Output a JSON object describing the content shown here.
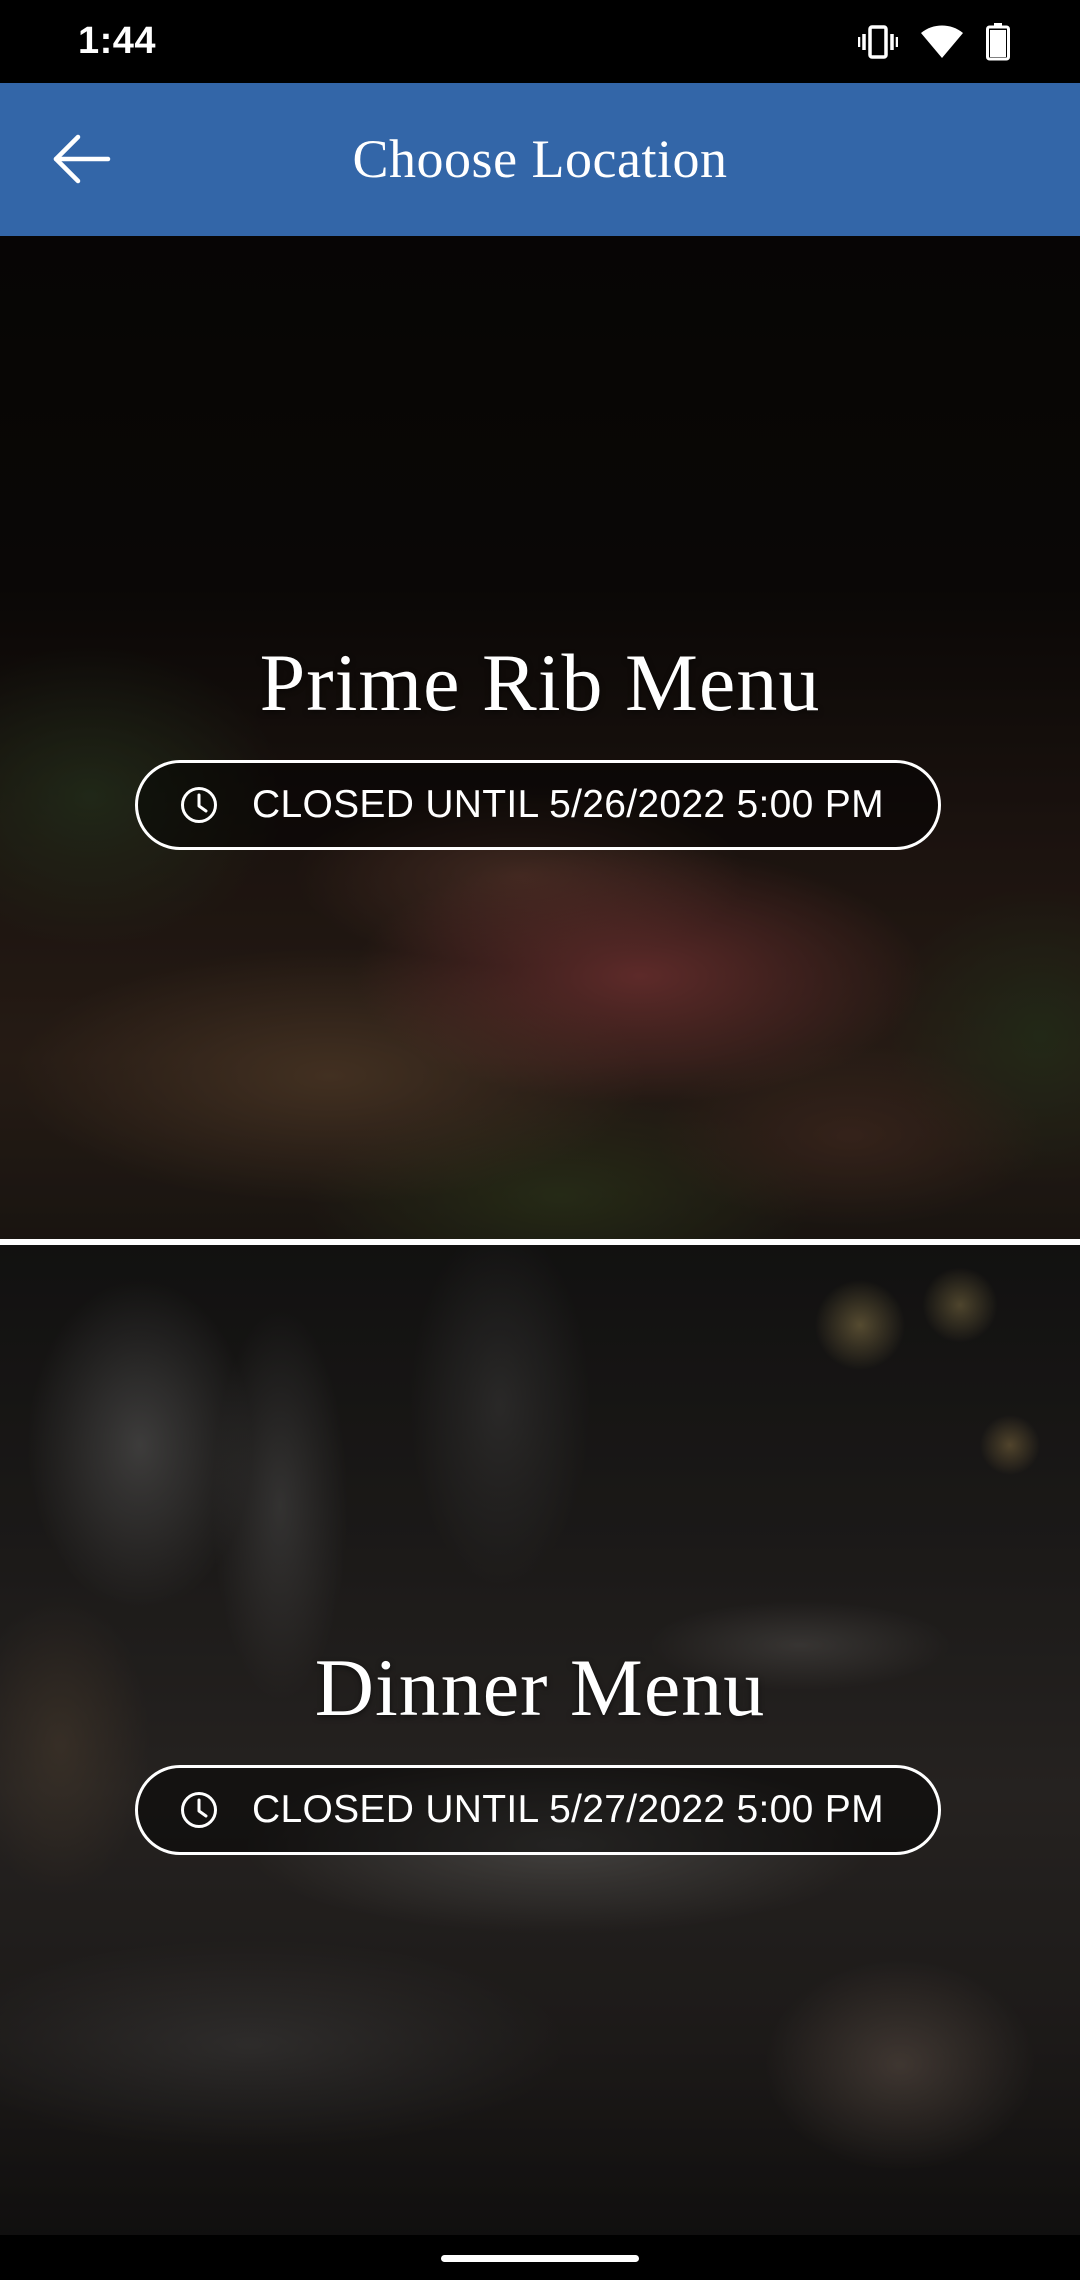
{
  "status_bar": {
    "time": "1:44",
    "icons": [
      "vibrate-icon",
      "wifi-icon",
      "battery-icon"
    ]
  },
  "app_bar": {
    "title": "Choose Location",
    "back_icon": "arrow-back-icon",
    "background_color": "#3366a8"
  },
  "locations": [
    {
      "title": "Prime Rib Menu",
      "status_icon": "clock-icon",
      "status": "CLOSED UNTIL 5/26/2022 5:00 PM"
    },
    {
      "title": "Dinner Menu",
      "status_icon": "clock-icon",
      "status": "CLOSED UNTIL 5/27/2022 5:00 PM"
    }
  ]
}
